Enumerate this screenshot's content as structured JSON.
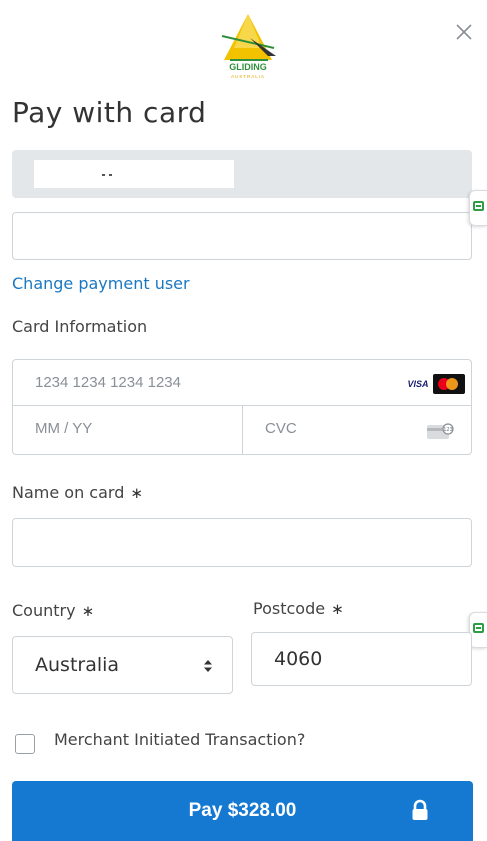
{
  "header": {
    "logo_text": "GLIDING",
    "logo_subtext": "AUSTRALIA",
    "close_symbol": "×",
    "title": "Pay with card"
  },
  "account": {
    "change_user_link": "Change payment user"
  },
  "card": {
    "section_label": "Card Information",
    "number_placeholder": "1234 1234 1234 1234",
    "expiry_placeholder": "MM / YY",
    "cvc_placeholder": "CVC",
    "brand_visa": "VISA",
    "icons": [
      "visa-icon",
      "mastercard-icon",
      "cvc-card-icon"
    ]
  },
  "name_on_card": {
    "label": "Name on card",
    "required_marker": "∗",
    "value": ""
  },
  "country": {
    "label": "Country",
    "required_marker": "∗",
    "selected": "Australia"
  },
  "postcode": {
    "label": "Postcode",
    "required_marker": "∗",
    "value": "4060"
  },
  "merchant_initiated": {
    "label": "Merchant Initiated Transaction?",
    "checked": false
  },
  "pay_button": {
    "label": "Pay $328.00"
  },
  "colors": {
    "accent": "#1679d1",
    "link": "#1a78c2",
    "logo_yellow": "#f2c200",
    "logo_green": "#2f8f3a",
    "helper_green": "#2e9e44"
  }
}
